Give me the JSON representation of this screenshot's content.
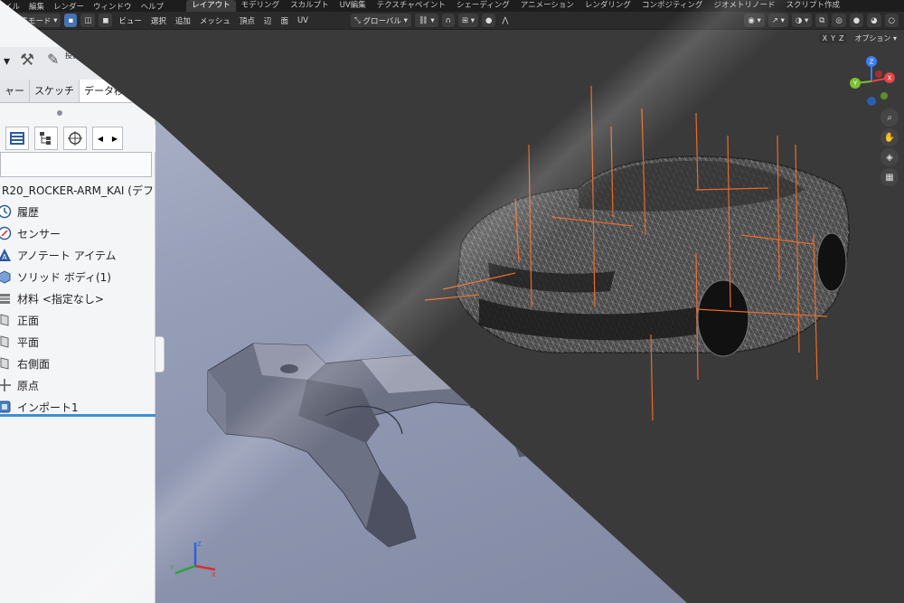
{
  "topmenu": {
    "menus": [
      "イル",
      "編集",
      "レンダー",
      "ウィンドウ",
      "ヘルプ"
    ],
    "workspaces": [
      {
        "label": "レイアウト",
        "active": true
      },
      {
        "label": "モデリング"
      },
      {
        "label": "スカルプト"
      },
      {
        "label": "UV編集"
      },
      {
        "label": "テクスチャペイント"
      },
      {
        "label": "シェーディング"
      },
      {
        "label": "アニメーション"
      },
      {
        "label": "レンダリング"
      },
      {
        "label": "コンポジティング"
      },
      {
        "label": "ジオメトリノード"
      },
      {
        "label": "スクリプト作成"
      }
    ]
  },
  "header": {
    "mode": "編集モード",
    "menus": [
      "ビュー",
      "選択",
      "追加",
      "メッシュ",
      "頂点",
      "辺",
      "面",
      "UV"
    ],
    "transform_orientation": "グローバル",
    "axis_x": "X",
    "axis_y": "Y",
    "axis_z": "Z",
    "options": "オプション"
  },
  "gizmo": {
    "x": "X",
    "y": "Y",
    "z": "Z"
  },
  "colors": {
    "accent": "#4772b3",
    "selection_bar": "#3a8fd6",
    "x_axis": "#e24545",
    "y_axis": "#7cc032",
    "z_axis": "#3c7df0"
  },
  "cad": {
    "tool_label": "投影",
    "tabs": [
      "ャー",
      "スケッチ",
      "データ移行"
    ],
    "tree_root": "R20_ROCKER-ARM_KAI (デフ",
    "tree": [
      {
        "label": "履歴",
        "icon": "history-icon"
      },
      {
        "label": "センサー",
        "icon": "sensor-icon"
      },
      {
        "label": "アノテート アイテム",
        "icon": "annotation-icon"
      },
      {
        "label": "ソリッド ボディ(1)",
        "icon": "solid-body-icon"
      },
      {
        "label": "材料 <指定なし>",
        "icon": "material-icon"
      },
      {
        "label": "正面",
        "icon": "plane-icon"
      },
      {
        "label": "平面",
        "icon": "plane-icon"
      },
      {
        "label": "右側面",
        "icon": "plane-icon"
      },
      {
        "label": "原点",
        "icon": "origin-icon"
      },
      {
        "label": "インポート1",
        "icon": "import-icon"
      }
    ],
    "triad": {
      "x": "X",
      "y": "Y",
      "z": "Z"
    }
  }
}
